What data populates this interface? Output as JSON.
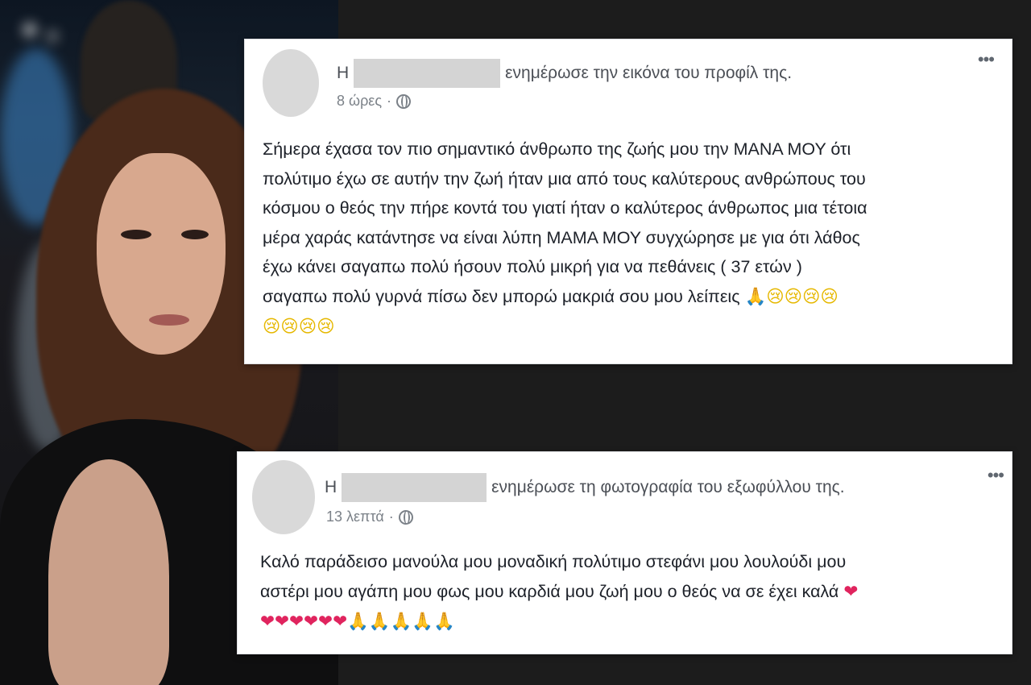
{
  "post1": {
    "name_initial": "Η",
    "action": "ενημέρωσε την εικόνα του προφίλ της.",
    "time": "8 ώρες",
    "text_lines": [
      "Σήμερα έχασα τον πιο σημαντικό άνθρωπο της ζωής μου την ΜΑΝΑ ΜΟΥ ότι",
      "πολύτιμο έχω σε αυτήν την ζωή ήταν μια από τους καλύτερους ανθρώπους του",
      "κόσμου ο θεός την πήρε κοντά του γιατί ήταν ο καλύτερος άνθρωπος μια τέτοια",
      "μέρα χαράς κατάντησε να είναι λύπη ΜΑΜΑ ΜΟΥ συγχώρησε με για ότι λάθος",
      "έχω κάνει σαγαπω πολύ ήσουν πολύ μικρή για να πεθάνεις ( 37 ετών )",
      "σαγαπω πολύ γυρνά πίσω δεν μπορώ μακριά σου μου λείπεις"
    ],
    "line6_emojis": "🙏😢😢😢😢",
    "line7_emojis": "😢😢😢😢"
  },
  "post2": {
    "name_initial": "Η",
    "action": "ενημέρωσε τη φωτογραφία του εξωφύλλου της.",
    "time": "13 λεπτά",
    "text_lines": [
      "Καλό παράδεισο μανούλα μου μοναδική πολύτιμο στεφάνι μου λουλούδι μου",
      "αστέρι μου αγάπη μου φως μου καρδιά μου ζωή μου ο θεός να σε έχει καλά"
    ],
    "line2_emoji": "❤",
    "line3_hearts": "❤❤❤❤❤❤",
    "line3_prays": "🙏🙏🙏🙏🙏"
  },
  "ui": {
    "meta_separator": "·",
    "more_glyph": "•••"
  },
  "icons": {
    "privacy": "globe-icon",
    "options": "more-options-icon"
  },
  "colors": {
    "card_bg": "#ffffff",
    "page_bg": "#1c1c1c",
    "meta_text": "#7b8188",
    "body_text": "#1d2129"
  }
}
